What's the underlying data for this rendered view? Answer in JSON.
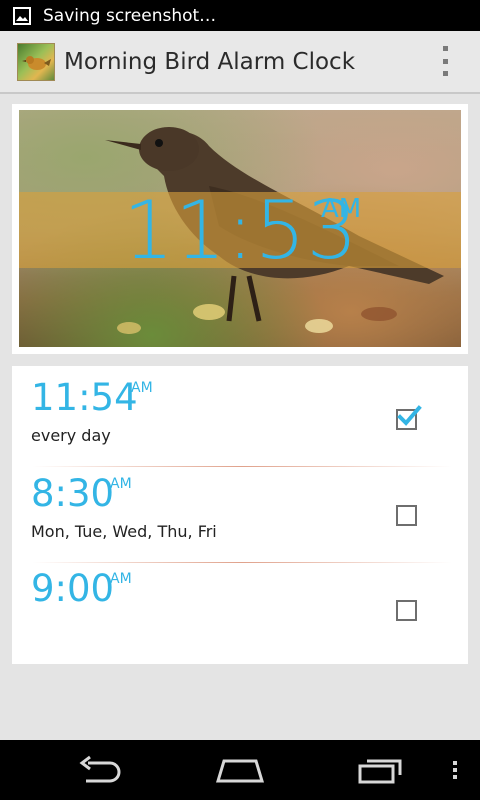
{
  "status_bar": {
    "notification_icon": "image-icon",
    "text": "Saving screenshot…"
  },
  "action_bar": {
    "title": "Morning Bird Alarm Clock",
    "app_icon": "bird-app-icon",
    "overflow_icon": "overflow-menu-icon"
  },
  "clock": {
    "time": "11:53",
    "ampm": "AM"
  },
  "alarms": [
    {
      "time": "11:54",
      "ampm": "AM",
      "days": "every day",
      "enabled": true
    },
    {
      "time": "8:30",
      "ampm": "AM",
      "days": "Mon, Tue, Wed, Thu, Fri",
      "enabled": false
    },
    {
      "time": "9:00",
      "ampm": "AM",
      "days": "",
      "enabled": false
    }
  ],
  "nav": {
    "back_icon": "back-icon",
    "home_icon": "home-icon",
    "recents_icon": "recent-apps-icon",
    "menu_icon": "menu-icon"
  },
  "colors": {
    "accent": "#33b5e5",
    "clock_band": "#d8a03c"
  }
}
